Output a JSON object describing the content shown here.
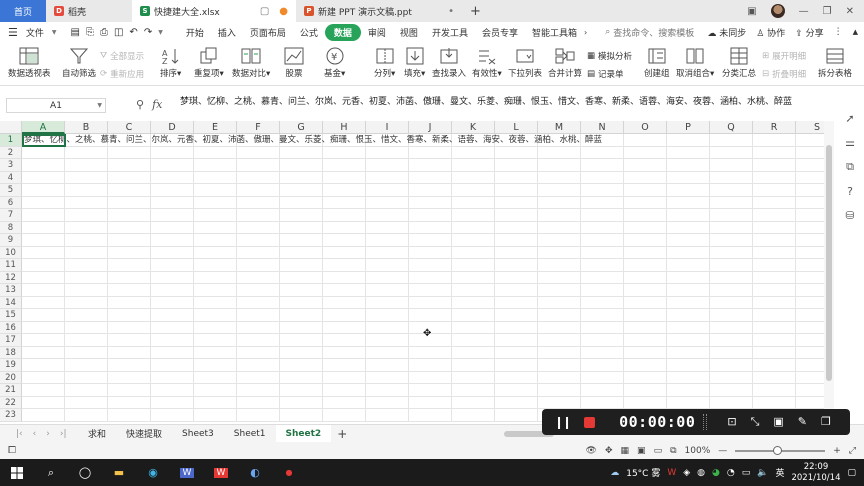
{
  "tabs": [
    {
      "label": "首页"
    },
    {
      "label": "稻壳"
    },
    {
      "label": "快捷建大全.xlsx"
    },
    {
      "label": "新建 PPT 演示文稿.ppt"
    }
  ],
  "menu": {
    "file": "文件",
    "tabs": [
      "开始",
      "插入",
      "页面布局",
      "公式",
      "数据",
      "审阅",
      "视图",
      "开发工具",
      "会员专享",
      "智能工具箱"
    ],
    "active_tab": "数据",
    "search_placeholder": "查找命令、搜索模板",
    "sync": "未同步",
    "collab": "协作",
    "share": "分享"
  },
  "ribbon": {
    "pivot": "数据透视表",
    "autofilter": "自动筛选",
    "show_all": "全部显示",
    "reapply": "重新应用",
    "sort": "排序",
    "duplicates": "重复项",
    "compare": "数据对比",
    "stocks": "股票",
    "funds": "基金",
    "split": "分列",
    "fill": "填充",
    "find_entry": "查找录入",
    "validity": "有效性",
    "dropdown": "下拉列表",
    "consolidate": "合并计算",
    "simulation": "模拟分析",
    "record": "记录单",
    "group": "创建组",
    "ungroup": "取消组合",
    "subtotal": "分类汇总",
    "expand": "展开明细",
    "collapse": "折叠明细",
    "split_table": "拆分表格"
  },
  "formula": {
    "cell_ref": "A1",
    "fx": "fx",
    "content": "梦琪、忆柳、之桃、慕青、问兰、尔岚、元香、初夏、沛菡、傲珊、曼文、乐菱、痴珊、恨玉、惜文、香寒、新柔、语蓉、海安、夜蓉、涵柏、水桃、醉蓝"
  },
  "grid": {
    "columns": [
      "A",
      "B",
      "C",
      "D",
      "E",
      "F",
      "G",
      "H",
      "I",
      "J",
      "K",
      "L",
      "M",
      "N",
      "O",
      "P",
      "Q",
      "R",
      "S"
    ],
    "rows": [
      "1",
      "2",
      "3",
      "4",
      "5",
      "6",
      "7",
      "8",
      "9",
      "10",
      "11",
      "12",
      "13",
      "14",
      "15",
      "16",
      "17",
      "18",
      "19",
      "20",
      "21",
      "22",
      "23"
    ],
    "a1_value": "梦琪、忆柳、之桃、慕青、问兰、尔岚、元香、初夏、沛菡、傲珊、曼文、乐菱、痴珊、恨玉、惜文、香寒、新柔、语蓉、海安、夜蓉、涵柏、水桃、醉蓝"
  },
  "sheets": [
    "求和",
    "快速提取",
    "Sheet3",
    "Sheet1",
    "Sheet2"
  ],
  "active_sheet": "Sheet2",
  "status": {
    "zoom": "100%",
    "zoom_fraction": 0.47
  },
  "recorder": {
    "time": "00:00:00"
  },
  "taskbar": {
    "weather": "15°C 雾",
    "ime": "英",
    "time": "22:09",
    "date": "2021/10/14"
  },
  "colors": {
    "accent_green": "#217346",
    "home_tab": "#3b76d6",
    "menu_active": "#27a35a",
    "record_red": "#e53935"
  }
}
